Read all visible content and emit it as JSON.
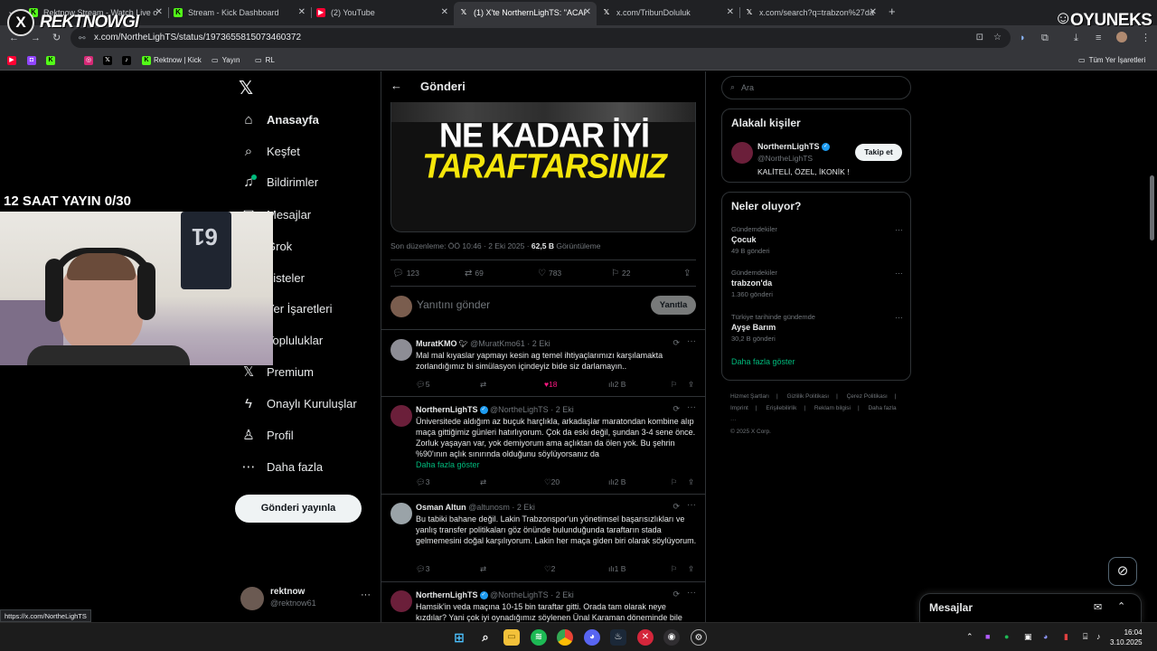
{
  "browser": {
    "tabs": [
      {
        "title": "Rektnow Stream - Watch Live o",
        "icon": "kick-icon",
        "active": false
      },
      {
        "title": "Stream - Kick Dashboard",
        "icon": "kick-icon",
        "active": false
      },
      {
        "title": "(2) YouTube",
        "icon": "youtube-icon",
        "active": false
      },
      {
        "title": "(1) X'te NorthernLighTS: \"ACAI",
        "icon": "x-icon",
        "active": true
      },
      {
        "title": "x.com/TribunDoluluk",
        "icon": "x-icon",
        "active": false
      },
      {
        "title": "x.com/search?q=trabzon%27da",
        "icon": "x-icon",
        "active": false
      }
    ],
    "new_tab": "+",
    "url": "x.com/NortheLighTS/status/1973655815073460372",
    "bookmarks": [
      {
        "label": "",
        "icon": "youtube-icon",
        "color": "#ff0033"
      },
      {
        "label": "",
        "icon": "twitch-icon",
        "color": "#9146ff"
      },
      {
        "label": "",
        "icon": "kick-icon",
        "color": "#53fc18"
      },
      {
        "label": "",
        "icon": "instagram-icon",
        "color": "#d62976"
      },
      {
        "label": "",
        "icon": "x-icon",
        "color": "#000000"
      },
      {
        "label": "",
        "icon": "tiktok-icon",
        "color": "#000000"
      },
      {
        "label": "Rektnow | Kick",
        "icon": "kick-icon",
        "color": "#53fc18"
      },
      {
        "label": "Yayın",
        "icon": "folder-icon",
        "color": ""
      },
      {
        "label": "RL",
        "icon": "folder-icon",
        "color": ""
      }
    ],
    "all_bookmarks": "Tüm Yer İşaretleri",
    "status_url": "https://x.com/NortheLighTS"
  },
  "overlay": {
    "stream_logo_text": "REKTNOWGI",
    "brand_logo_text": "OYUNEKS",
    "timer_text": "12 SAAT YAYIN 0/30",
    "webcam_jersey_number": "61"
  },
  "nav": {
    "items": [
      {
        "label": "Anasayfa",
        "icon": "home-icon"
      },
      {
        "label": "Keşfet",
        "icon": "search-icon"
      },
      {
        "label": "Bildirimler",
        "icon": "bell-icon"
      },
      {
        "label": "Mesajlar",
        "icon": "mail-icon"
      },
      {
        "label": "Grok",
        "icon": "grok-icon"
      },
      {
        "label": "Listeler",
        "icon": "list-icon"
      },
      {
        "label": "Yer İşaretleri",
        "icon": "bookmark-icon"
      },
      {
        "label": "Topluluklar",
        "icon": "community-icon"
      },
      {
        "label": "Premium",
        "icon": "x-premium-icon"
      },
      {
        "label": "Onaylı Kuruluşlar",
        "icon": "lightning-icon"
      },
      {
        "label": "Profil",
        "icon": "profile-icon"
      },
      {
        "label": "Daha fazla",
        "icon": "more-circle-icon"
      }
    ],
    "post_button": "Gönderi yayınla",
    "account_name": "rektnow",
    "account_handle": "@rektnow61"
  },
  "main": {
    "title": "Gönderi",
    "media_line1": "NE KADAR İYİ",
    "media_line2": "TARAFTARSINIZ",
    "meta_prefix": "Son düzenleme: ÖÖ 10:46 · 2 Eki 2025 · ",
    "meta_views": "62,5 B",
    "meta_suffix": " Görüntüleme",
    "stats": {
      "replies": "123",
      "reposts": "69",
      "likes": "783",
      "bookmarks": "22"
    },
    "reply_placeholder": "Yanıtını gönder",
    "reply_button": "Yanıtla",
    "replies": [
      {
        "name": "MuratKMO",
        "handle": "@MuratKmo61",
        "date": "· 2 Eki",
        "verified": false,
        "text": "Mal mal kıyaslar yapmayı kesin ag temel ihtiyaçlarımızı karşılamakta zorlandığımız bi simülasyon içindeyiz bide siz darlamayın..",
        "more": "",
        "replies": "5",
        "reposts": "",
        "likes": "18",
        "views": "2 B",
        "liked": true,
        "avatar_color": "#8d8d95"
      },
      {
        "name": "NorthernLighTS",
        "handle": "@NortheLighTS",
        "date": "· 2 Eki",
        "verified": true,
        "text": "Üniversitede aldığım az buçuk harçlıkla, arkadaşlar maratondan kombine alıp maça gittiğimiz günleri hatırlıyorum. Çok da eski değil, şundan 3-4 sene önce. Zorluk yaşayan var, yok demiyorum ama açlıktan da ölen yok. Bu şehrin %90'ının açlık sınırında olduğunu söylüyorsanız da",
        "more": "Daha fazla göster",
        "replies": "3",
        "reposts": "",
        "likes": "20",
        "views": "2 B",
        "liked": false,
        "avatar_color": "#6b1f3a"
      },
      {
        "name": "Osman Altun",
        "handle": "@altunosm",
        "date": "· 2 Eki",
        "verified": false,
        "text": "Bu tabiki bahane değil. Lakin Trabzonspor'un yönetimsel başarısızlıkları ve yanlış transfer politikaları göz önünde bulunduğunda taraftarın stada gelmemesini doğal karşılıyorum. Lakin her maça giden biri olarak söylüyorum.",
        "more": "",
        "replies": "3",
        "reposts": "",
        "likes": "2",
        "views": "1 B",
        "liked": false,
        "avatar_color": "#9aa3a8"
      },
      {
        "name": "NorthernLighTS",
        "handle": "@NortheLighTS",
        "date": "· 2 Eki",
        "verified": true,
        "text": "Hamsik'in veda maçına 10-15 bin taraftar gitti. Orada tam olarak neye kızdılar? Yani çok iyi oynadığımız söylenen Ünal Karaman döneminde bile",
        "more": "",
        "replies": "",
        "reposts": "",
        "likes": "",
        "views": "",
        "liked": false,
        "avatar_color": "#6b1f3a"
      }
    ]
  },
  "sidebar": {
    "search_placeholder": "Ara",
    "related_title": "Alakalı kişiler",
    "related": {
      "name": "NorthernLighTS",
      "handle": "@NortheLighTS",
      "bio": "KALİTELİ, ÖZEL, İKONİK !",
      "follow": "Takip et"
    },
    "trends_title": "Neler oluyor?",
    "trends": [
      {
        "context": "Gündemdekiler",
        "topic": "Çocuk",
        "posts": "49 B gönderi"
      },
      {
        "context": "Gündemdekiler",
        "topic": "trabzon'da",
        "posts": "1.360 gönderi"
      },
      {
        "context": "Türkiye tarihinde gündemde",
        "topic": "Ayşe Barım",
        "posts": "30,2 B gönderi"
      }
    ],
    "show_more": "Daha fazla göster",
    "footer": [
      "Hizmet Şartları",
      "|",
      "Gizlilik Politikası",
      "|",
      "Çerez Politikası",
      "|",
      "Imprint",
      "|",
      "Erişilebilirlik",
      "|",
      "Reklam bilgisi",
      "|",
      "Daha fazla ···",
      "© 2025 X Corp."
    ],
    "dm_title": "Mesajlar"
  },
  "taskbar": {
    "time": "16:04",
    "date": "3.10.2025"
  },
  "colors": {
    "accent_green": "#00ba7c",
    "verified_blue": "#1d9bf0",
    "like_pink": "#f91880",
    "media_yellow": "#f5e60a"
  }
}
